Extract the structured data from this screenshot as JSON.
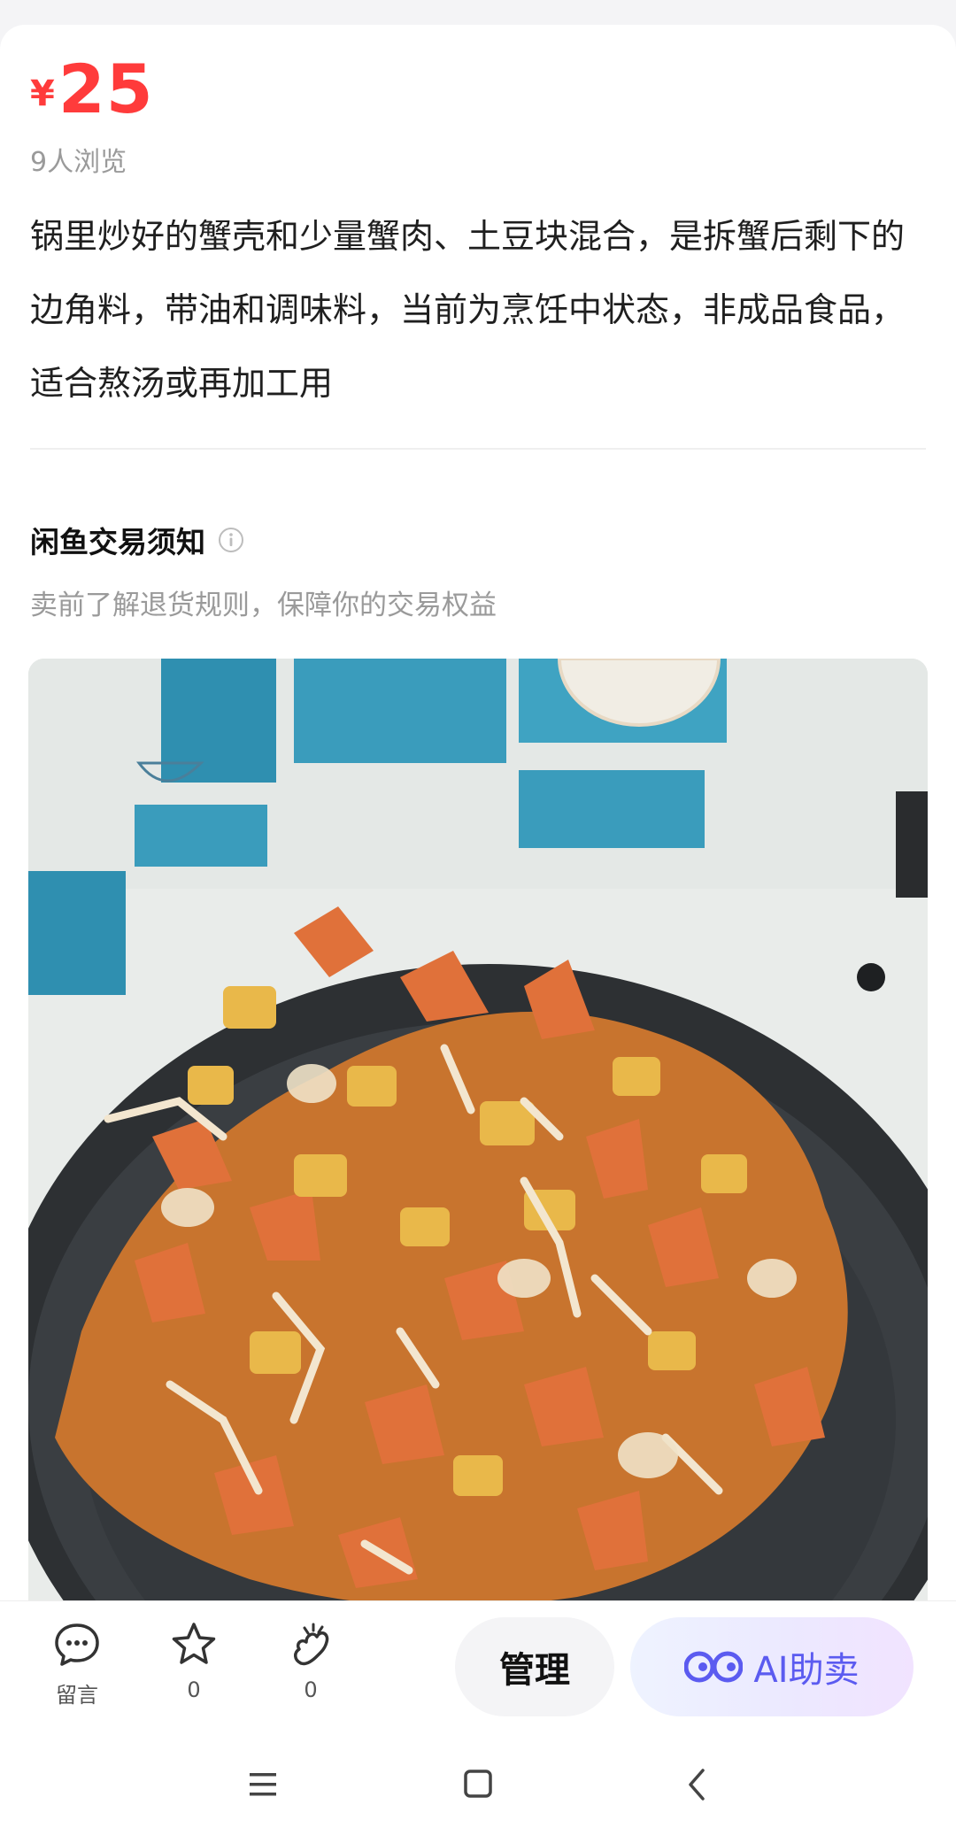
{
  "product": {
    "currency": "¥",
    "price": "25",
    "views": "9人浏览",
    "description": "锅里炒好的蟹壳和少量蟹肉、土豆块混合，是拆蟹后剩下的边角料，带油和调味料，当前为烹饪中状态，非成品食品，适合熬汤或再加工用"
  },
  "notice": {
    "title": "闲鱼交易须知",
    "subtitle": "卖前了解退货规则，保障你的交易权益",
    "icon": "info-icon"
  },
  "photo": {
    "subject": "crab-shells-in-wok",
    "colors": {
      "wall": "#e9ecea",
      "tile": "#3a9cbc",
      "wok": "#2d3033",
      "crab": "#e0713a",
      "potato": "#e9b84a"
    }
  },
  "bottom_bar": {
    "comment_label": "留言",
    "favorite_count": "0",
    "want_count": "0",
    "manage_label": "管理",
    "ai_label": "AI助卖"
  },
  "nav": {
    "icons": [
      "menu-icon",
      "home-icon",
      "back-icon"
    ]
  },
  "colors": {
    "price": "#ff3b3b",
    "ai_text": "#5b5bf0"
  }
}
